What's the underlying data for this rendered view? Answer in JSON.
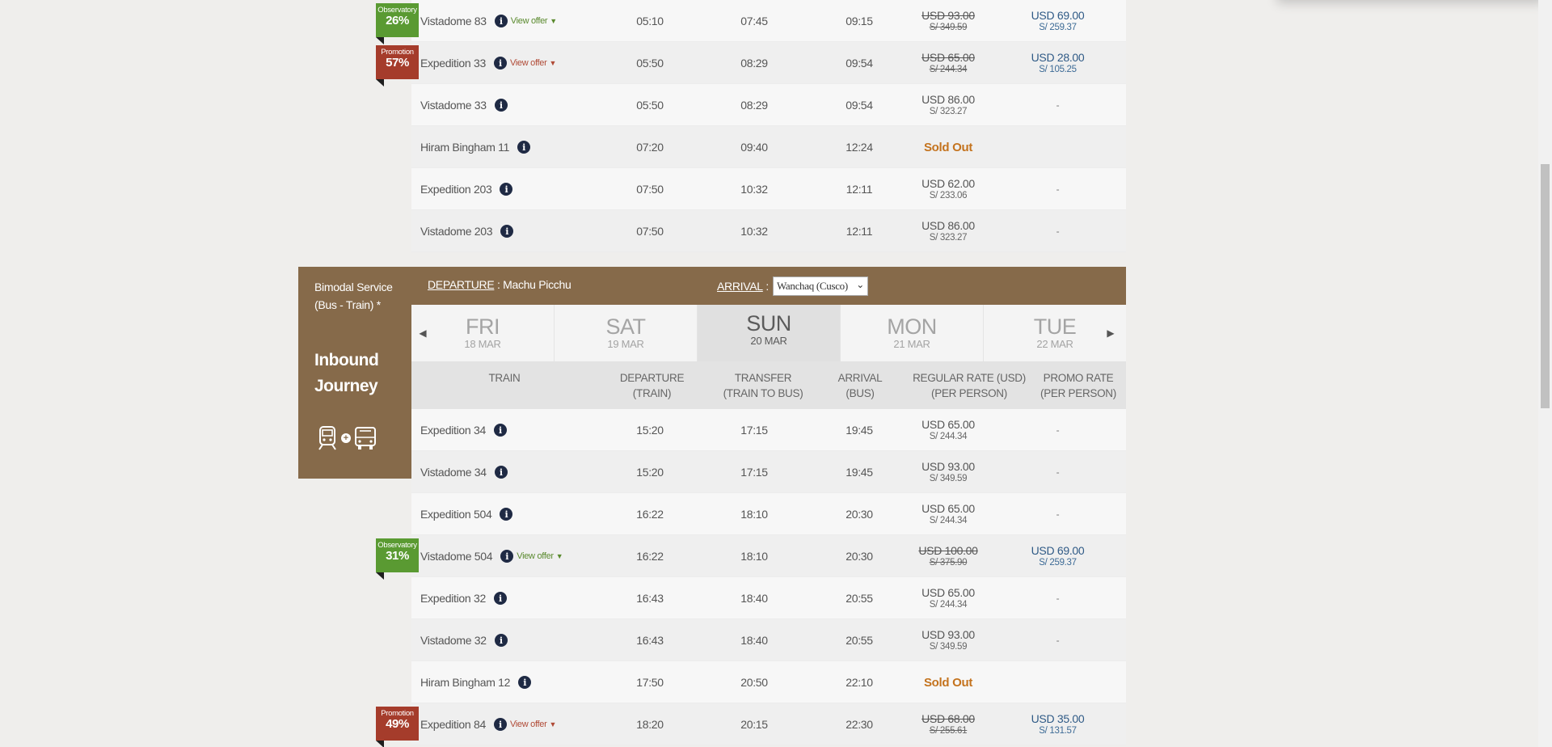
{
  "outbound_rows": [
    {
      "train": "Vistadome 83",
      "offer": "View offer",
      "offer_color": "green",
      "dep": "05:10",
      "transfer": "07:45",
      "arr": "09:15",
      "reg_usd": "USD 93.00",
      "reg_pen": "S/ 349.59",
      "reg_strike": true,
      "promo_usd": "USD 69.00",
      "promo_pen": "S/ 259.37",
      "ribbon": {
        "label": "Observatory",
        "pct": "26%",
        "color": "green"
      }
    },
    {
      "train": "Expedition 33",
      "offer": "View offer",
      "offer_color": "red",
      "dep": "05:50",
      "transfer": "08:29",
      "arr": "09:54",
      "reg_usd": "USD 65.00",
      "reg_pen": "S/ 244.34",
      "reg_strike": true,
      "promo_usd": "USD 28.00",
      "promo_pen": "S/ 105.25",
      "ribbon": {
        "label": "Promotion",
        "pct": "57%",
        "color": "red"
      }
    },
    {
      "train": "Vistadome 33",
      "dep": "05:50",
      "transfer": "08:29",
      "arr": "09:54",
      "reg_usd": "USD 86.00",
      "reg_pen": "S/ 323.27",
      "promo": "-"
    },
    {
      "train": "Hiram Bingham 11",
      "dep": "07:20",
      "transfer": "09:40",
      "arr": "12:24",
      "sold_out": "Sold Out"
    },
    {
      "train": "Expedition 203",
      "dep": "07:50",
      "transfer": "10:32",
      "arr": "12:11",
      "reg_usd": "USD 62.00",
      "reg_pen": "S/ 233.06",
      "promo": "-"
    },
    {
      "train": "Vistadome 203",
      "dep": "07:50",
      "transfer": "10:32",
      "arr": "12:11",
      "reg_usd": "USD 86.00",
      "reg_pen": "S/ 323.27",
      "promo": "-"
    }
  ],
  "inbound": {
    "service": "Bimodal Service (Bus - Train) *",
    "service_line1": "Bimodal Service",
    "service_line2": "(Bus - Train) *",
    "journey_line1": "Inbound",
    "journey_line2": "Journey",
    "departure_label": "DEPARTURE",
    "departure_value": "Machu Picchu",
    "arrival_label": "ARRIVAL",
    "arrival_selected": "Wanchaq (Cusco)",
    "days": [
      {
        "name": "FRI",
        "date": "18 MAR",
        "active": false
      },
      {
        "name": "SAT",
        "date": "19 MAR",
        "active": false
      },
      {
        "name": "SUN",
        "date": "20 MAR",
        "active": true
      },
      {
        "name": "MON",
        "date": "21 MAR",
        "active": false
      },
      {
        "name": "TUE",
        "date": "22 MAR",
        "active": false
      }
    ],
    "headers": {
      "train": "TRAIN",
      "dep1": "DEPARTURE",
      "dep2": "(TRAIN)",
      "trn1": "TRANSFER",
      "trn2": "(TRAIN TO BUS)",
      "arr1": "ARRIVAL",
      "arr2": "(BUS)",
      "reg1": "REGULAR RATE (USD)",
      "reg2": "(PER PERSON)",
      "pro1": "PROMO RATE",
      "pro2": "(PER PERSON)"
    },
    "rows": [
      {
        "train": "Expedition 34",
        "dep": "15:20",
        "transfer": "17:15",
        "arr": "19:45",
        "reg_usd": "USD 65.00",
        "reg_pen": "S/ 244.34",
        "promo": "-"
      },
      {
        "train": "Vistadome 34",
        "dep": "15:20",
        "transfer": "17:15",
        "arr": "19:45",
        "reg_usd": "USD 93.00",
        "reg_pen": "S/ 349.59",
        "promo": "-"
      },
      {
        "train": "Expedition 504",
        "dep": "16:22",
        "transfer": "18:10",
        "arr": "20:30",
        "reg_usd": "USD 65.00",
        "reg_pen": "S/ 244.34",
        "promo": "-"
      },
      {
        "train": "Vistadome 504",
        "offer": "View offer",
        "offer_color": "green",
        "dep": "16:22",
        "transfer": "18:10",
        "arr": "20:30",
        "reg_usd": "USD 100.00",
        "reg_pen": "S/ 375.90",
        "reg_strike": true,
        "promo_usd": "USD 69.00",
        "promo_pen": "S/ 259.37",
        "ribbon": {
          "label": "Observatory",
          "pct": "31%",
          "color": "green"
        }
      },
      {
        "train": "Expedition 32",
        "dep": "16:43",
        "transfer": "18:40",
        "arr": "20:55",
        "reg_usd": "USD 65.00",
        "reg_pen": "S/ 244.34",
        "promo": "-"
      },
      {
        "train": "Vistadome 32",
        "dep": "16:43",
        "transfer": "18:40",
        "arr": "20:55",
        "reg_usd": "USD 93.00",
        "reg_pen": "S/ 349.59",
        "promo": "-"
      },
      {
        "train": "Hiram Bingham 12",
        "dep": "17:50",
        "transfer": "20:50",
        "arr": "22:10",
        "sold_out": "Sold Out"
      },
      {
        "train": "Expedition 84",
        "offer": "View offer",
        "offer_color": "red",
        "dep": "18:20",
        "transfer": "20:15",
        "arr": "22:30",
        "reg_usd": "USD 68.00",
        "reg_pen": "S/ 255.61",
        "reg_strike": true,
        "promo_usd": "USD 35.00",
        "promo_pen": "S/ 131.57",
        "ribbon": {
          "label": "Promotion",
          "pct": "49%",
          "color": "red"
        }
      }
    ]
  },
  "icons": {
    "info": "i",
    "caret": "▼",
    "prev": "◀",
    "next": "▶",
    "select_caret": "⌄",
    "plus": "+"
  }
}
